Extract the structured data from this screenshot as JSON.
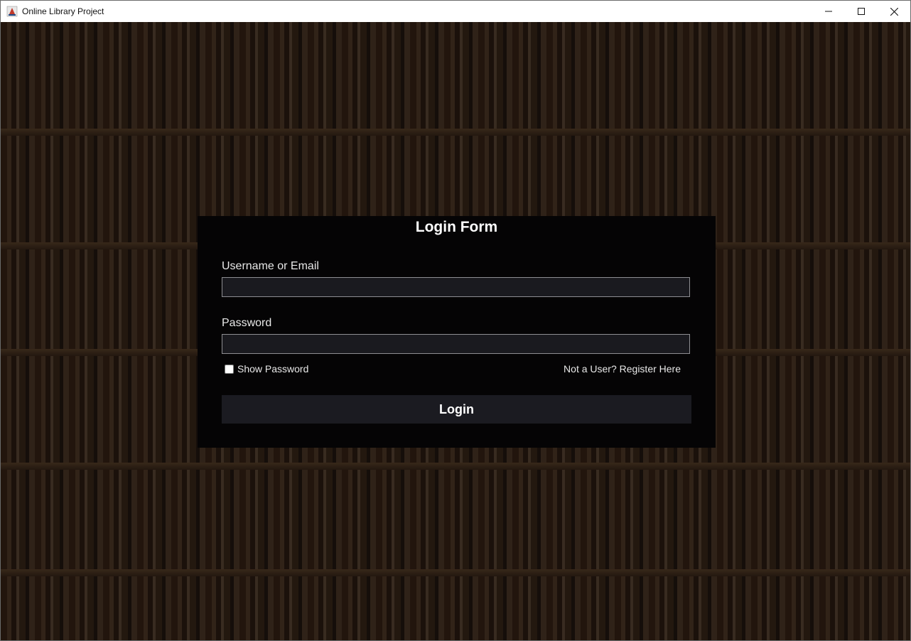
{
  "window": {
    "title": "Online Library Project",
    "app_icon": "java-cup-icon",
    "controls": [
      "minimize-icon",
      "maximize-icon",
      "close-icon"
    ]
  },
  "login_form": {
    "title": "Login Form",
    "username_label": "Username or Email",
    "username_value": "",
    "password_label": "Password",
    "password_value": "",
    "show_password_label": "Show Password",
    "show_password_checked": false,
    "register_link": "Not a User? Register Here",
    "login_button": "Login"
  },
  "colors": {
    "panel_bg": "#050405",
    "field_bg": "#1a1a1f",
    "button_bg": "#1b1b21",
    "text": "#ffffff"
  },
  "background": "bookshelf-photo"
}
